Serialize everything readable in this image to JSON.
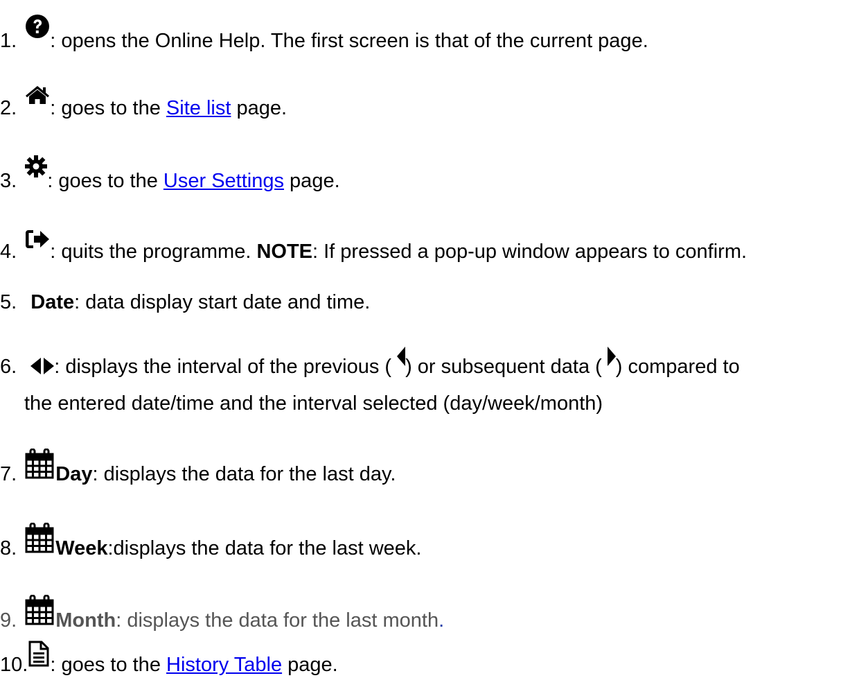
{
  "items": [
    {
      "num": "1.",
      "icon": "question-circle-icon",
      "text": ": opens the Online Help. The first screen is that of the current page."
    },
    {
      "num": "2.",
      "icon": "home-icon",
      "pre": ": goes to the ",
      "link": "Site list",
      "post": " page."
    },
    {
      "num": "3.",
      "icon": "gear-icon",
      "pre": ": goes to the ",
      "link": "User Settings",
      "post": " page."
    },
    {
      "num": "4.",
      "icon": "sign-out-icon",
      "text": ": quits the programme. ",
      "bold": "NOTE",
      "text2": ": If pressed a pop-up window appears to confirm."
    },
    {
      "num": "5.",
      "bold": "Date",
      "text": ": data display start date and time."
    },
    {
      "num": "6.",
      "icon": "left-right-arrows-icon",
      "text": ": displays the interval of the previous (",
      "text2": ") or subsequent data (",
      "text3": ") compared to",
      "line2": "the entered date/time and the interval selected (day/week/month)"
    },
    {
      "num": "7.",
      "icon": "calendar-icon",
      "bold": "Day",
      "text": ": displays the data for the last day."
    },
    {
      "num": "8.",
      "icon": "calendar-icon",
      "bold": "Week",
      "text": ":displays the data for the last week."
    },
    {
      "num": "9.",
      "icon": "calendar-icon",
      "bold": "Month",
      "text": ": displays the data for the last month",
      "period": "."
    },
    {
      "num": "10.",
      "icon": "document-icon",
      "pre": ": goes to the ",
      "link": "History Table",
      "post": " page."
    }
  ]
}
